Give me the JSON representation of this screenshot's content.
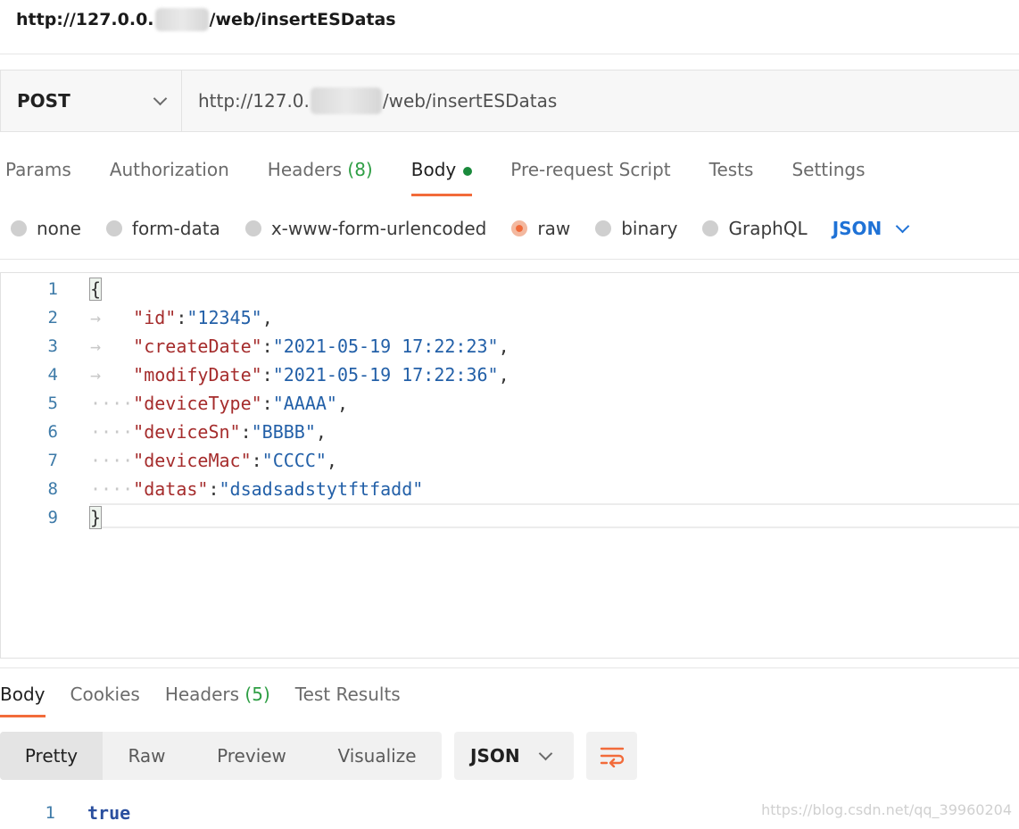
{
  "page": {
    "title_prefix": "http://127.0.0.",
    "title_suffix": "/web/insertESDatas"
  },
  "request": {
    "method": "POST",
    "url_prefix": "http://127.0.",
    "url_suffix": "/web/insertESDatas"
  },
  "request_tabs": [
    {
      "label": "Params"
    },
    {
      "label": "Authorization"
    },
    {
      "label": "Headers",
      "count": "(8)"
    },
    {
      "label": "Body",
      "active": true
    },
    {
      "label": "Pre-request Script"
    },
    {
      "label": "Tests"
    },
    {
      "label": "Settings"
    }
  ],
  "body_types": [
    {
      "label": "none"
    },
    {
      "label": "form-data"
    },
    {
      "label": "x-www-form-urlencoded"
    },
    {
      "label": "raw",
      "selected": true
    },
    {
      "label": "binary"
    },
    {
      "label": "GraphQL"
    }
  ],
  "body_language": "JSON",
  "editor_lines": [
    {
      "num": "1",
      "open": "{"
    },
    {
      "num": "2",
      "key": "\"id\"",
      "value": "\"12345\"",
      "comma": ","
    },
    {
      "num": "3",
      "key": "\"createDate\"",
      "value": "\"2021-05-19 17:22:23\"",
      "comma": ","
    },
    {
      "num": "4",
      "key": "\"modifyDate\"",
      "value": "\"2021-05-19 17:22:36\"",
      "comma": ","
    },
    {
      "num": "5",
      "key": "\"deviceType\"",
      "value": "\"AAAA\"",
      "comma": ","
    },
    {
      "num": "6",
      "key": "\"deviceSn\"",
      "value": "\"BBBB\"",
      "comma": ","
    },
    {
      "num": "7",
      "key": "\"deviceMac\"",
      "value": "\"CCCC\"",
      "comma": ","
    },
    {
      "num": "8",
      "key": "\"datas\"",
      "value": "\"dsadsadstytftfadd\"",
      "comma": ""
    },
    {
      "num": "9",
      "close": "}"
    }
  ],
  "response_tabs": [
    {
      "label": "Body",
      "active": true
    },
    {
      "label": "Cookies"
    },
    {
      "label": "Headers",
      "count": "(5)"
    },
    {
      "label": "Test Results"
    }
  ],
  "response_views": [
    "Pretty",
    "Raw",
    "Preview",
    "Visualize"
  ],
  "response_format": "JSON",
  "response_line": {
    "num": "1",
    "value": "true"
  },
  "watermark": "https://blog.csdn.net/qq_39960204",
  "colors": {
    "accent": "#f26b3a",
    "count_green": "#2e9e44",
    "link_blue": "#1f72d6"
  }
}
